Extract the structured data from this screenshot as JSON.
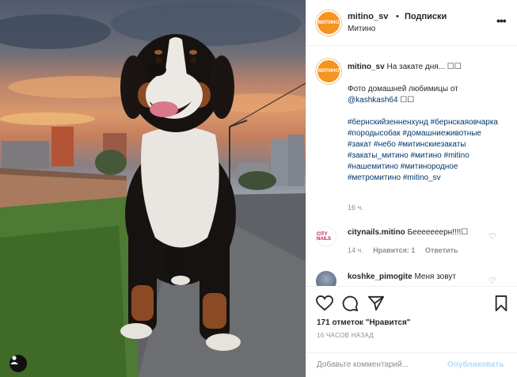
{
  "post": {
    "username": "mitino_sv",
    "dot": "•",
    "follow_label": "Подписки",
    "location": "Митино",
    "more_label": "•••",
    "avatar_text": "МИТИНО"
  },
  "caption": {
    "username": "mitino_sv",
    "title": "На закате дня... ☐☐",
    "body": "Фото домашней любимицы от",
    "mention": "@kashkash64",
    "mention_suffix": " ☐☐",
    "hashtags": "#бернскийзенненхунд #бернскаяовчарка #породысобак #домашниеживотные #закат #небо #митинскиезакаты #закаты_митино #митино #mitino #нашемитино #митинородное #метромитино #mitino_sv",
    "time": "16 ч."
  },
  "comments": [
    {
      "username": "citynails.mitino",
      "text": "Бееееееерн!!!!☐",
      "time": "14 ч.",
      "likes": "Нравится: 1",
      "reply": "Ответить",
      "avatar_text": "CITY NAILS"
    },
    {
      "username": "koshke_pimogite",
      "text": "Меня зовут"
    }
  ],
  "actions": {
    "likes_text": "171 отметок \"Нравится\"",
    "time_ago": "16 ЧАСОВ НАЗАД",
    "add_comment_placeholder": "Добавьте комментарий...",
    "publish_label": "Опубликовать"
  },
  "icons": [
    "heart-icon",
    "comment-icon",
    "share-icon",
    "bookmark-icon",
    "user-tag-icon",
    "more-options-icon"
  ],
  "colors": {
    "link": "#00376b",
    "accent": "#f7931e",
    "muted": "#8e8e8e",
    "publish": "#b3dbff"
  }
}
